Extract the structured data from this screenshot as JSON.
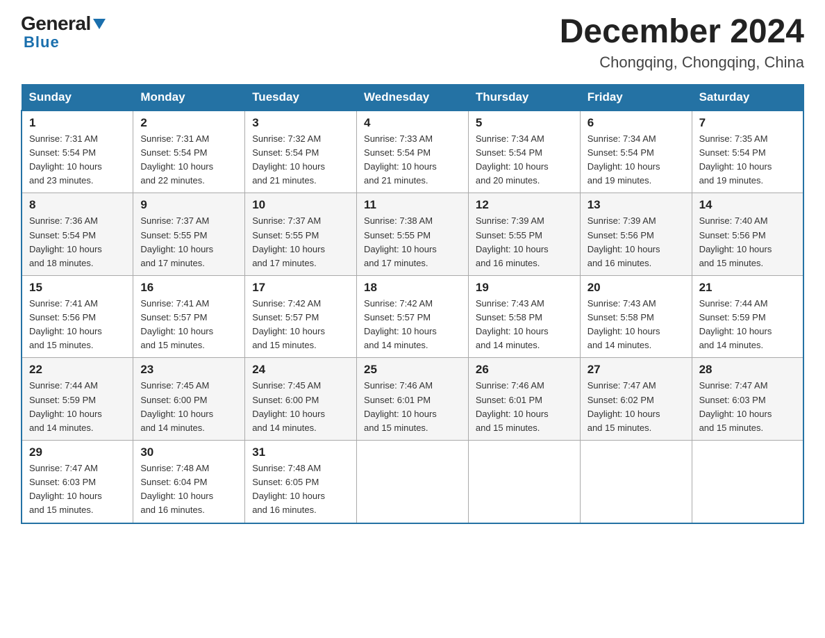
{
  "header": {
    "logo_general": "General",
    "logo_blue": "Blue",
    "month_title": "December 2024",
    "location": "Chongqing, Chongqing, China"
  },
  "days_of_week": [
    "Sunday",
    "Monday",
    "Tuesday",
    "Wednesday",
    "Thursday",
    "Friday",
    "Saturday"
  ],
  "weeks": [
    [
      {
        "day": "1",
        "sunrise": "7:31 AM",
        "sunset": "5:54 PM",
        "daylight": "10 hours and 23 minutes."
      },
      {
        "day": "2",
        "sunrise": "7:31 AM",
        "sunset": "5:54 PM",
        "daylight": "10 hours and 22 minutes."
      },
      {
        "day": "3",
        "sunrise": "7:32 AM",
        "sunset": "5:54 PM",
        "daylight": "10 hours and 21 minutes."
      },
      {
        "day": "4",
        "sunrise": "7:33 AM",
        "sunset": "5:54 PM",
        "daylight": "10 hours and 21 minutes."
      },
      {
        "day": "5",
        "sunrise": "7:34 AM",
        "sunset": "5:54 PM",
        "daylight": "10 hours and 20 minutes."
      },
      {
        "day": "6",
        "sunrise": "7:34 AM",
        "sunset": "5:54 PM",
        "daylight": "10 hours and 19 minutes."
      },
      {
        "day": "7",
        "sunrise": "7:35 AM",
        "sunset": "5:54 PM",
        "daylight": "10 hours and 19 minutes."
      }
    ],
    [
      {
        "day": "8",
        "sunrise": "7:36 AM",
        "sunset": "5:54 PM",
        "daylight": "10 hours and 18 minutes."
      },
      {
        "day": "9",
        "sunrise": "7:37 AM",
        "sunset": "5:55 PM",
        "daylight": "10 hours and 17 minutes."
      },
      {
        "day": "10",
        "sunrise": "7:37 AM",
        "sunset": "5:55 PM",
        "daylight": "10 hours and 17 minutes."
      },
      {
        "day": "11",
        "sunrise": "7:38 AM",
        "sunset": "5:55 PM",
        "daylight": "10 hours and 17 minutes."
      },
      {
        "day": "12",
        "sunrise": "7:39 AM",
        "sunset": "5:55 PM",
        "daylight": "10 hours and 16 minutes."
      },
      {
        "day": "13",
        "sunrise": "7:39 AM",
        "sunset": "5:56 PM",
        "daylight": "10 hours and 16 minutes."
      },
      {
        "day": "14",
        "sunrise": "7:40 AM",
        "sunset": "5:56 PM",
        "daylight": "10 hours and 15 minutes."
      }
    ],
    [
      {
        "day": "15",
        "sunrise": "7:41 AM",
        "sunset": "5:56 PM",
        "daylight": "10 hours and 15 minutes."
      },
      {
        "day": "16",
        "sunrise": "7:41 AM",
        "sunset": "5:57 PM",
        "daylight": "10 hours and 15 minutes."
      },
      {
        "day": "17",
        "sunrise": "7:42 AM",
        "sunset": "5:57 PM",
        "daylight": "10 hours and 15 minutes."
      },
      {
        "day": "18",
        "sunrise": "7:42 AM",
        "sunset": "5:57 PM",
        "daylight": "10 hours and 14 minutes."
      },
      {
        "day": "19",
        "sunrise": "7:43 AM",
        "sunset": "5:58 PM",
        "daylight": "10 hours and 14 minutes."
      },
      {
        "day": "20",
        "sunrise": "7:43 AM",
        "sunset": "5:58 PM",
        "daylight": "10 hours and 14 minutes."
      },
      {
        "day": "21",
        "sunrise": "7:44 AM",
        "sunset": "5:59 PM",
        "daylight": "10 hours and 14 minutes."
      }
    ],
    [
      {
        "day": "22",
        "sunrise": "7:44 AM",
        "sunset": "5:59 PM",
        "daylight": "10 hours and 14 minutes."
      },
      {
        "day": "23",
        "sunrise": "7:45 AM",
        "sunset": "6:00 PM",
        "daylight": "10 hours and 14 minutes."
      },
      {
        "day": "24",
        "sunrise": "7:45 AM",
        "sunset": "6:00 PM",
        "daylight": "10 hours and 14 minutes."
      },
      {
        "day": "25",
        "sunrise": "7:46 AM",
        "sunset": "6:01 PM",
        "daylight": "10 hours and 15 minutes."
      },
      {
        "day": "26",
        "sunrise": "7:46 AM",
        "sunset": "6:01 PM",
        "daylight": "10 hours and 15 minutes."
      },
      {
        "day": "27",
        "sunrise": "7:47 AM",
        "sunset": "6:02 PM",
        "daylight": "10 hours and 15 minutes."
      },
      {
        "day": "28",
        "sunrise": "7:47 AM",
        "sunset": "6:03 PM",
        "daylight": "10 hours and 15 minutes."
      }
    ],
    [
      {
        "day": "29",
        "sunrise": "7:47 AM",
        "sunset": "6:03 PM",
        "daylight": "10 hours and 15 minutes."
      },
      {
        "day": "30",
        "sunrise": "7:48 AM",
        "sunset": "6:04 PM",
        "daylight": "10 hours and 16 minutes."
      },
      {
        "day": "31",
        "sunrise": "7:48 AM",
        "sunset": "6:05 PM",
        "daylight": "10 hours and 16 minutes."
      },
      null,
      null,
      null,
      null
    ]
  ],
  "labels": {
    "sunrise": "Sunrise:",
    "sunset": "Sunset:",
    "daylight": "Daylight:"
  }
}
